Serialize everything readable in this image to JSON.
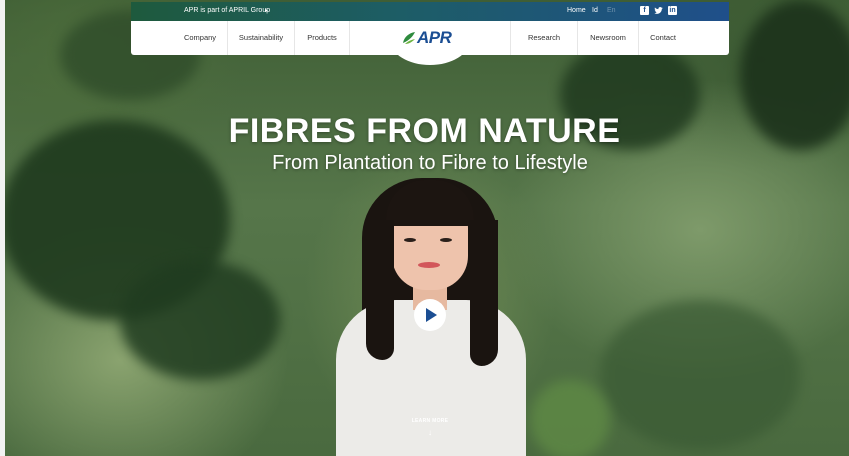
{
  "topbar": {
    "group_text": "APR is part of APRIL Group",
    "caret": "▸",
    "home": "Home",
    "lang_id": "Id",
    "lang_en": "En",
    "social": {
      "facebook": "f",
      "twitter": "🐦",
      "linkedin": "in"
    }
  },
  "nav": {
    "items_left": [
      "Company",
      "Sustainability",
      "Products"
    ],
    "items_right": [
      "Research",
      "Newsroom",
      "Contact"
    ],
    "logo_text": "APR"
  },
  "hero": {
    "headline": "FIBRES FROM NATURE",
    "subline": "From Plantation to Fibre to Lifestyle",
    "learn_more": "LEARN MORE",
    "learn_more_arrow": "↓"
  },
  "colors": {
    "brand_blue": "#1b4e93",
    "brand_green": "#2e8b3e",
    "topbar_gradient_start": "#1e5a3d",
    "topbar_gradient_end": "#1f4f8a"
  },
  "icons": [
    "facebook-icon",
    "twitter-icon",
    "linkedin-icon",
    "play-icon",
    "arrow-down-icon",
    "leaf-logo-icon"
  ]
}
